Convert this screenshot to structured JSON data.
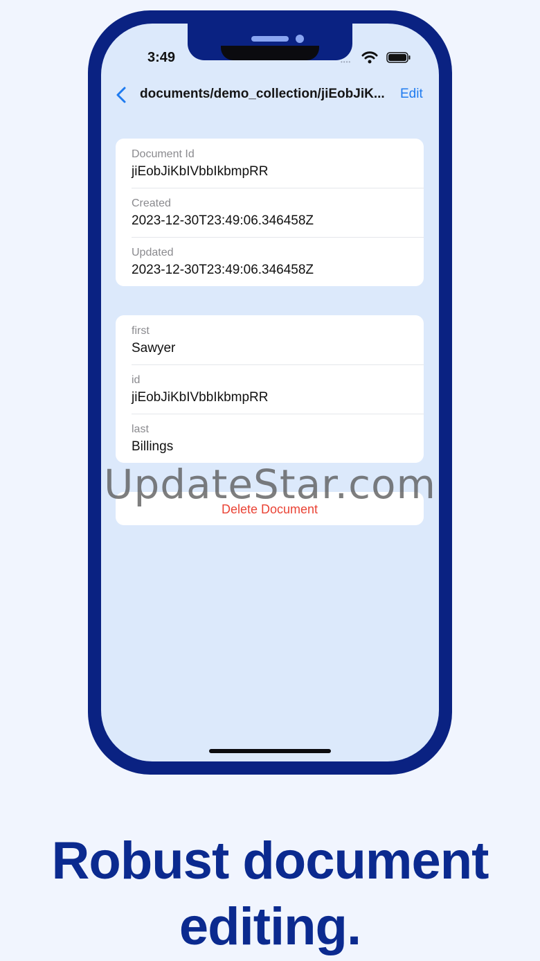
{
  "status_bar": {
    "time": "3:49",
    "signal_dots": "••••",
    "icons": [
      "signal-dots-icon",
      "wifi-icon",
      "battery-icon"
    ]
  },
  "navigation": {
    "back_icon": "chevron-left-icon",
    "title": "documents/demo_collection/jiEobJiK...",
    "edit_label": "Edit"
  },
  "metadata_card": {
    "rows": [
      {
        "label": "Document Id",
        "value": "jiEobJiKbIVbbIkbmpRR"
      },
      {
        "label": "Created",
        "value": "2023-12-30T23:49:06.346458Z"
      },
      {
        "label": "Updated",
        "value": "2023-12-30T23:49:06.346458Z"
      }
    ]
  },
  "fields_card": {
    "rows": [
      {
        "label": "first",
        "value": "Sawyer"
      },
      {
        "label": "id",
        "value": "jiEobJiKbIVbbIkbmpRR"
      },
      {
        "label": "last",
        "value": "Billings"
      }
    ]
  },
  "actions": {
    "delete_label": "Delete Document"
  },
  "watermark": "UpdateStar.com",
  "headline": {
    "line1": "Robust document",
    "line2": "editing."
  },
  "colors": {
    "frame": "#0a2282",
    "screen_bg": "#dce9fb",
    "page_bg": "#f1f5fe",
    "accent": "#1f7bef",
    "destructive": "#ea4335",
    "headline": "#0b2a8f"
  }
}
